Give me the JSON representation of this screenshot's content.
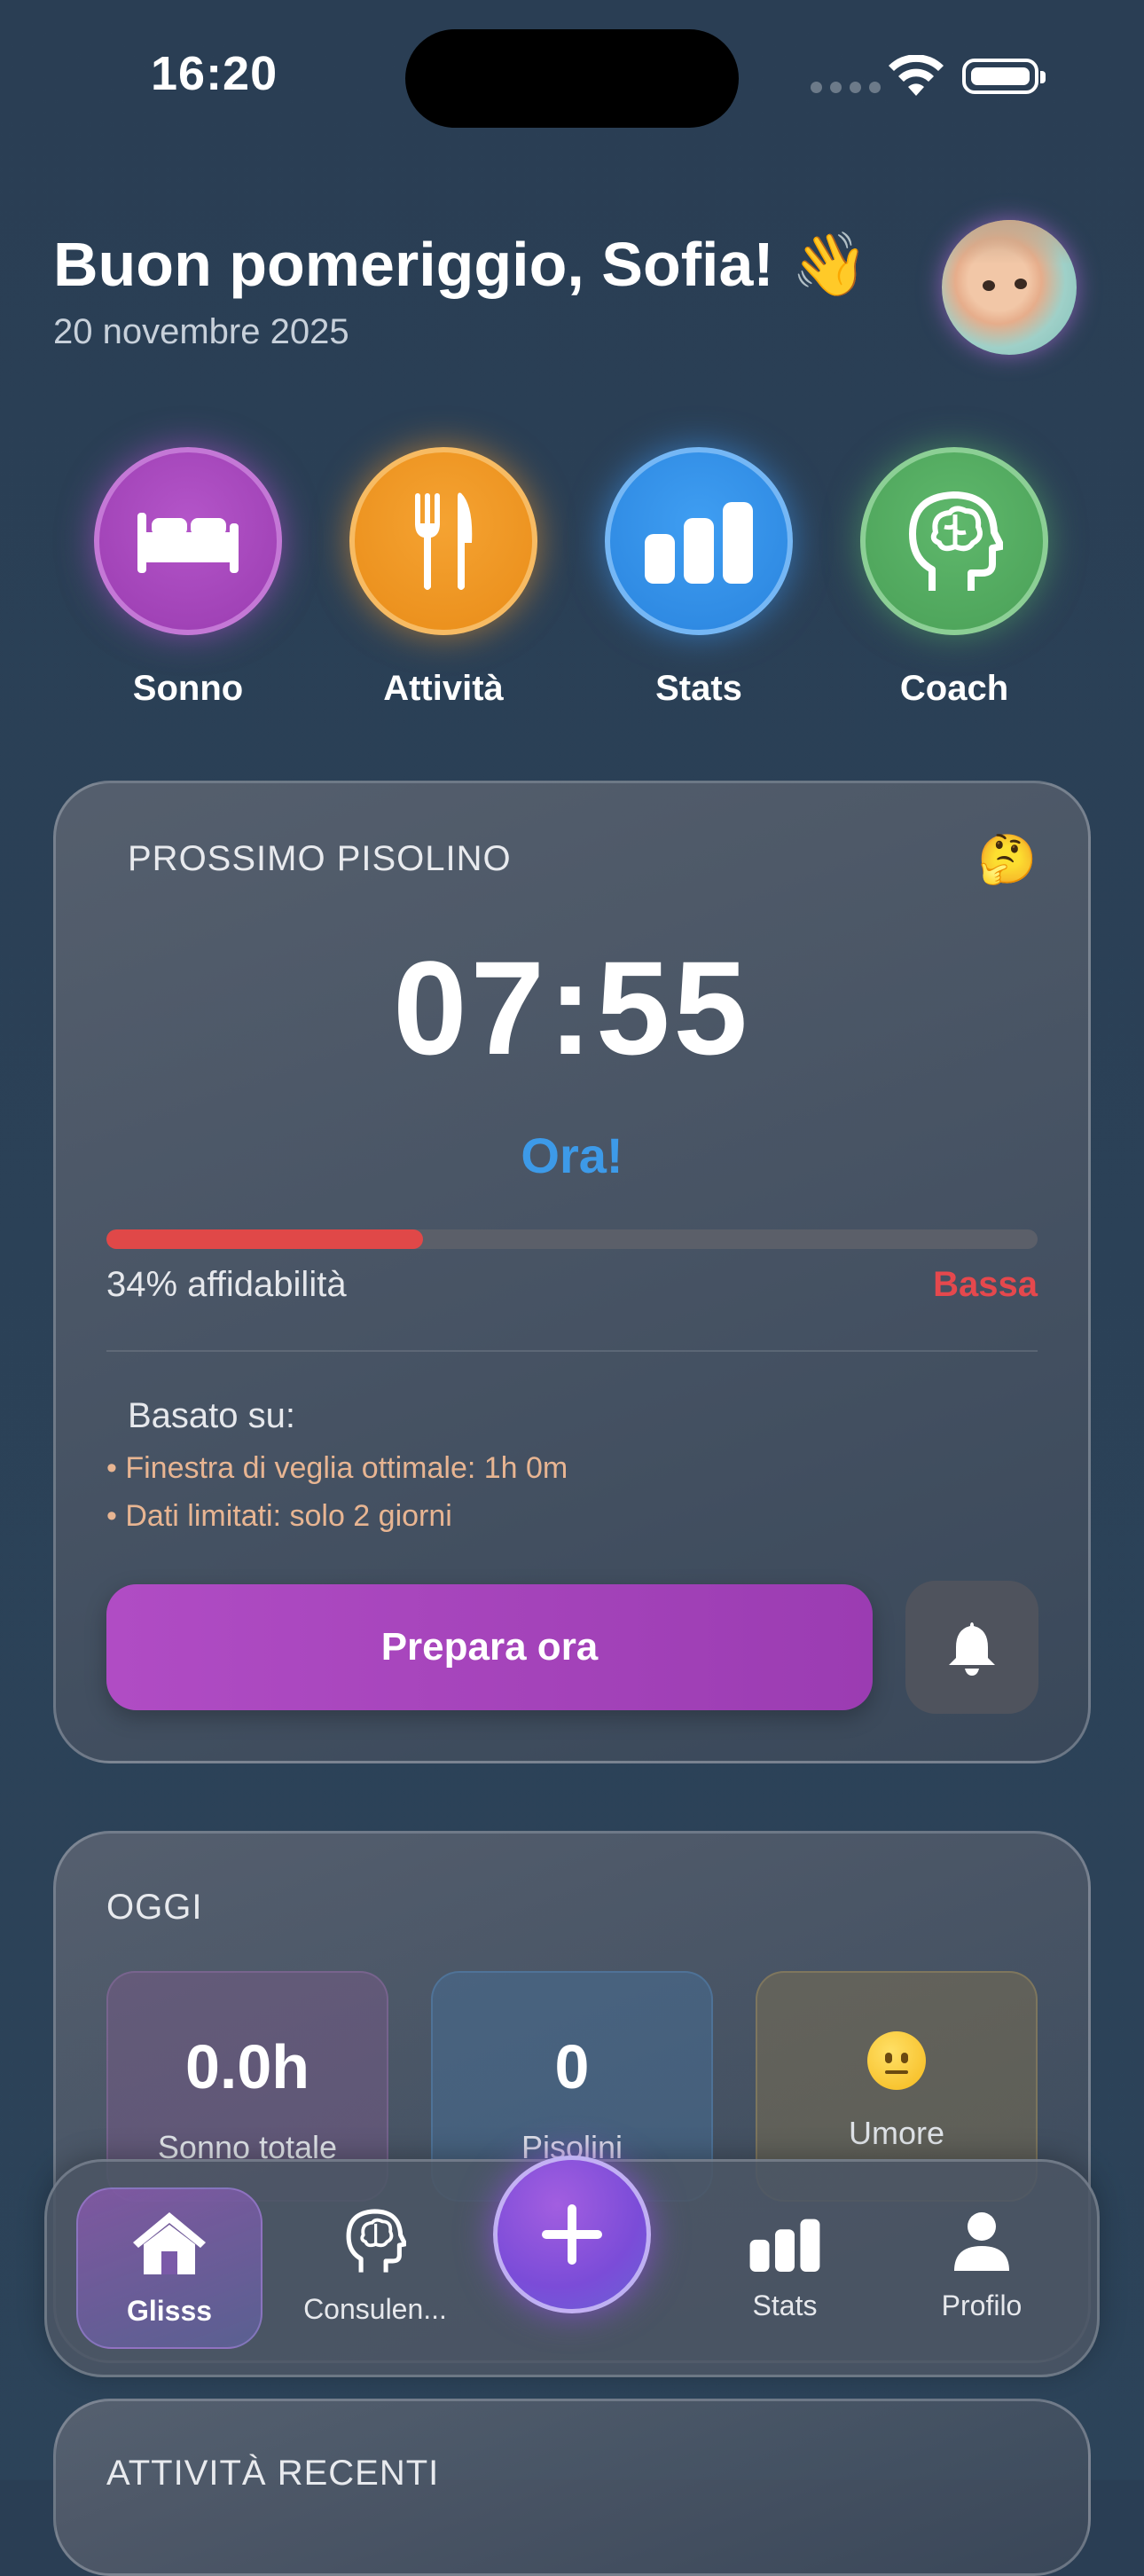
{
  "status_bar": {
    "time": "16:20"
  },
  "header": {
    "greeting": "Buon pomeriggio, Sofia! 👋",
    "date": "20 novembre 2025"
  },
  "quick_actions": [
    {
      "label": "Sonno",
      "icon": "bed-icon",
      "color": "#a646bd"
    },
    {
      "label": "Attività",
      "icon": "fork-knife-icon",
      "color": "#f09a25"
    },
    {
      "label": "Stats",
      "icon": "bar-chart-icon",
      "color": "#358fe8"
    },
    {
      "label": "Coach",
      "icon": "brain-head-icon",
      "color": "#55ad62"
    }
  ],
  "next_nap": {
    "title": "PROSSIMO PISOLINO",
    "emoji": "🤔",
    "time": "07:55",
    "status": "Ora!",
    "reliability_percent": 34,
    "reliability_text": "34% affidabilità",
    "reliability_level": "Bassa",
    "based_on_label": "Basato su:",
    "reasons": [
      "• Finestra di veglia ottimale: 1h 0m",
      "• Dati limitati: solo 2 giorni"
    ],
    "prepare_button": "Prepara ora"
  },
  "today": {
    "title": "OGGI",
    "tiles": [
      {
        "value": "0.0h",
        "label": "Sonno totale"
      },
      {
        "value": "0",
        "label": "Pisolini"
      },
      {
        "value": "😐",
        "label": "Umore"
      }
    ]
  },
  "recent": {
    "title": "ATTIVITÀ RECENTI"
  },
  "tabbar": {
    "items": [
      {
        "label": "Glisss",
        "icon": "home-icon",
        "active": true
      },
      {
        "label": "Consulen...",
        "icon": "brain-head-icon"
      },
      {
        "label": "Stats",
        "icon": "bar-chart-icon"
      },
      {
        "label": "Profilo",
        "icon": "person-icon"
      }
    ]
  }
}
